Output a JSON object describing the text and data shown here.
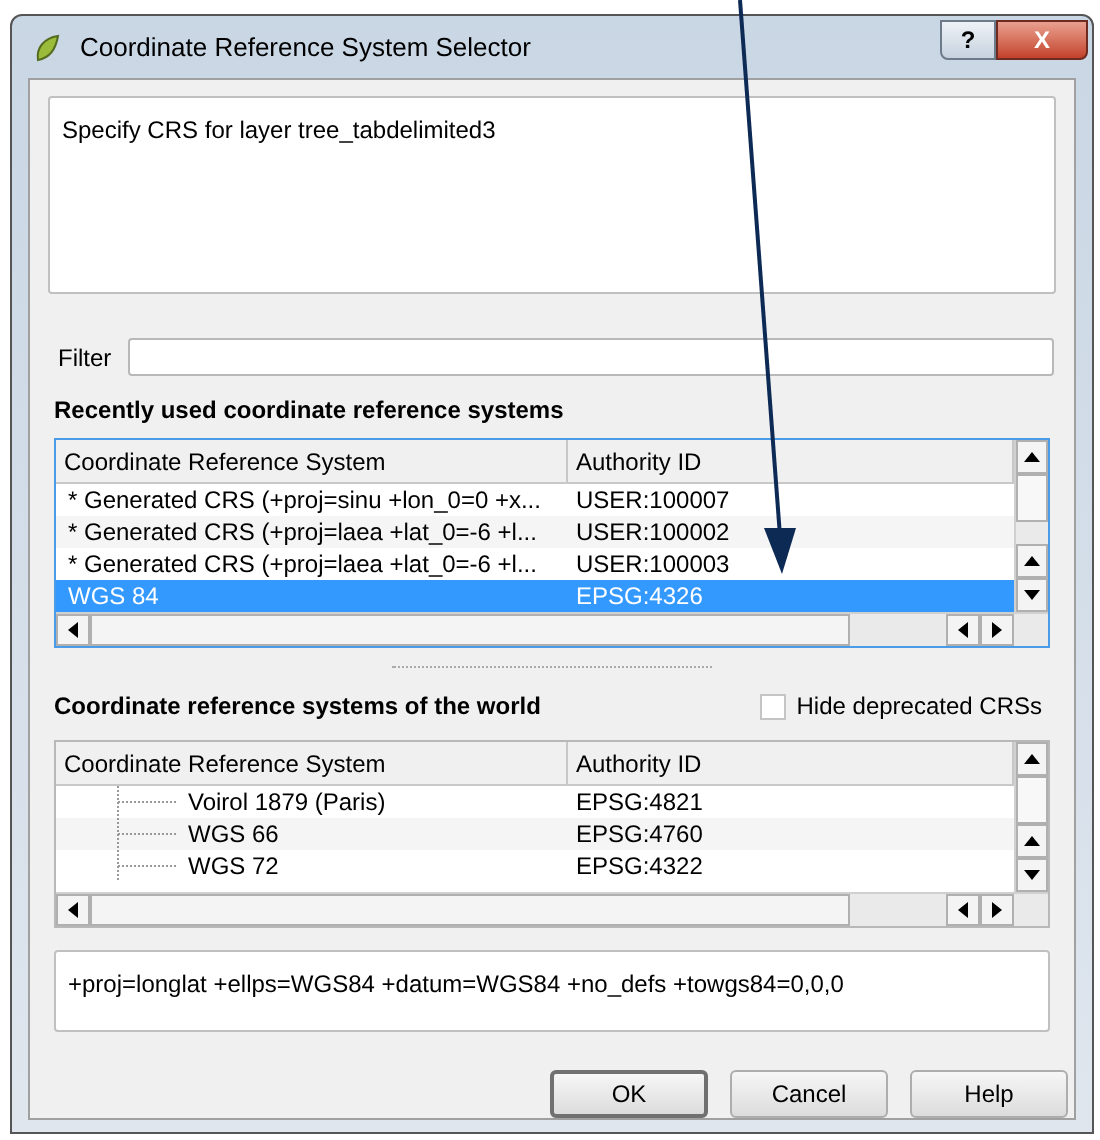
{
  "window": {
    "title": "Coordinate Reference System Selector",
    "help_button": "?",
    "close_button": "X"
  },
  "description": "Specify CRS for layer tree_tabdelimited3",
  "filter": {
    "label": "Filter"
  },
  "recent": {
    "title": "Recently used coordinate reference systems",
    "columns": [
      "Coordinate Reference System",
      "Authority ID"
    ],
    "rows": [
      {
        "name": "* Generated CRS (+proj=sinu +lon_0=0 +x...",
        "id": "USER:100007",
        "selected": false
      },
      {
        "name": "* Generated CRS (+proj=laea +lat_0=-6 +l...",
        "id": "USER:100002",
        "selected": false
      },
      {
        "name": "* Generated CRS (+proj=laea +lat_0=-6 +l...",
        "id": "USER:100003",
        "selected": false
      },
      {
        "name": "WGS 84",
        "id": "EPSG:4326",
        "selected": true
      }
    ]
  },
  "world": {
    "title": "Coordinate reference systems of the world",
    "hide_deprecated": {
      "label": "Hide deprecated CRSs",
      "checked": false
    },
    "columns": [
      "Coordinate Reference System",
      "Authority ID"
    ],
    "rows": [
      {
        "name": "Voirol 1879 (Paris)",
        "id": "EPSG:4821",
        "selected": false
      },
      {
        "name": "WGS 66",
        "id": "EPSG:4760",
        "selected": false
      },
      {
        "name": "WGS 72",
        "id": "EPSG:4322",
        "selected": false
      }
    ]
  },
  "proj_string": "+proj=longlat +ellps=WGS84 +datum=WGS84 +no_defs +towgs84=0,0,0",
  "buttons": [
    {
      "label": "OK",
      "default": true
    },
    {
      "label": "Cancel",
      "default": false
    },
    {
      "label": "Help",
      "default": false
    }
  ]
}
